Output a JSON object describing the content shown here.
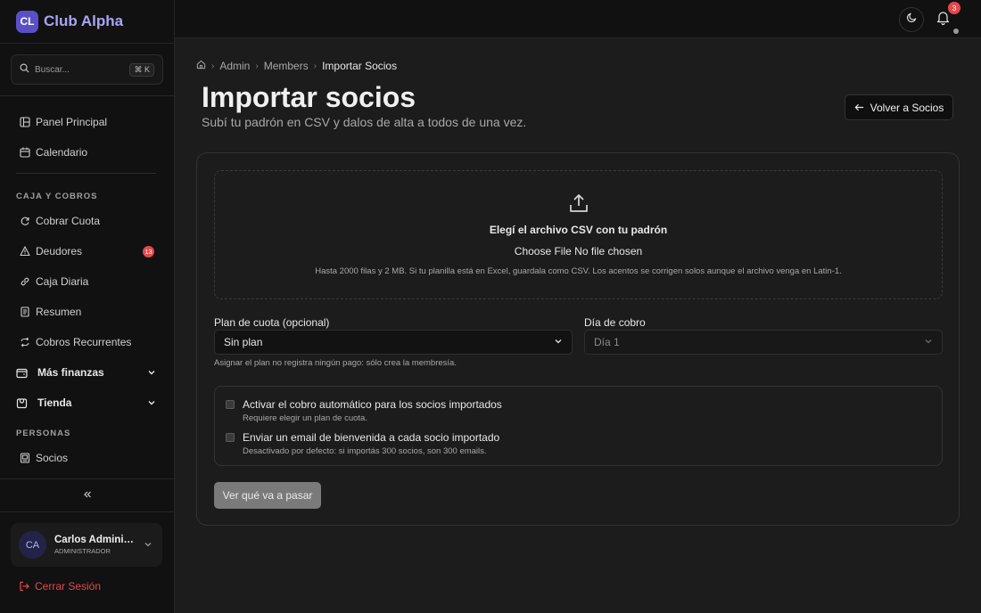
{
  "brand": {
    "logo_text": "CL",
    "name": "Club Alpha"
  },
  "search": {
    "placeholder": "Buscar...",
    "shortcut": "⌘ K"
  },
  "sidebar": {
    "top_items": [
      {
        "label": "Panel Principal",
        "icon": "dashboard-icon"
      },
      {
        "label": "Calendario",
        "icon": "calendar-icon"
      }
    ],
    "section_caja": "CAJA Y COBROS",
    "caja_items": [
      {
        "label": "Cobrar Cuota",
        "icon": "refresh-icon"
      },
      {
        "label": "Deudores",
        "icon": "warning-icon",
        "badge": "13"
      },
      {
        "label": "Caja Diaria",
        "icon": "link-icon"
      },
      {
        "label": "Resumen",
        "icon": "receipt-icon"
      },
      {
        "label": "Cobros Recurrentes",
        "icon": "repeat-icon"
      }
    ],
    "groups": [
      {
        "label": "Más finanzas",
        "icon": "wallet-icon"
      },
      {
        "label": "Tienda",
        "icon": "store-icon"
      }
    ],
    "section_personas": "PERSONAS",
    "personas_items": [
      {
        "label": "Socios",
        "icon": "members-icon"
      }
    ]
  },
  "user": {
    "initials": "CA",
    "name": "Carlos Adminis...",
    "role": "ADMINISTRADOR"
  },
  "logout_label": "Cerrar Sesión",
  "topbar": {
    "notifications": "3"
  },
  "breadcrumb": {
    "items": [
      "Admin",
      "Members"
    ],
    "current": "Importar Socios"
  },
  "page": {
    "title": "Importar socios",
    "subtitle": "Subí tu padrón en CSV y dalos de alta a todos de una vez.",
    "back_label": "Volver a Socios"
  },
  "upload": {
    "title": "Elegí el archivo CSV con tu padrón",
    "file_input": "Choose File No file chosen",
    "hint": "Hasta 2000 filas y 2 MB. Si tu planilla está en Excel, guardala como CSV. Los acentos se corrigen solos aunque el archivo venga en Latin-1."
  },
  "plan": {
    "label": "Plan de cuota (opcional)",
    "value": "Sin plan",
    "hint": "Asignar el plan no registra ningún pago: sólo crea la membresía."
  },
  "billing_day": {
    "label": "Día de cobro",
    "value": "Día 1"
  },
  "options": [
    {
      "title": "Activar el cobro automático para los socios importados",
      "desc": "Requiere elegir un plan de cuota.",
      "checked": false
    },
    {
      "title": "Enviar un email de bienvenida a cada socio importado",
      "desc": "Desactivado por defecto: si importás 300 socios, son 300 emails.",
      "checked": false
    }
  ],
  "preview_label": "Ver qué va a pasar",
  "colors": {
    "accent": "#5b4fc7",
    "brand_text": "#a9a4f5",
    "danger": "#e5484d"
  }
}
